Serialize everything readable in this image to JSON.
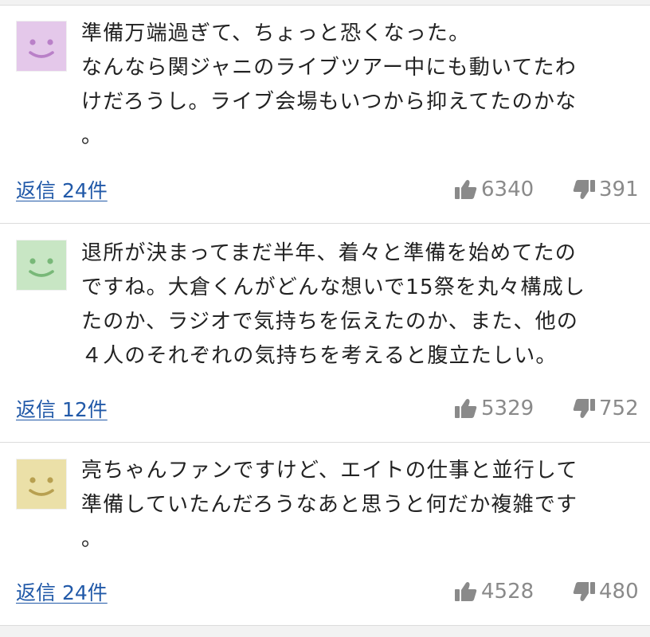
{
  "comments": [
    {
      "avatar": {
        "color": "#e4c8ea",
        "face_color": "#b980c8",
        "icon": "smiley-face-icon"
      },
      "lines": [
        "準備万端過ぎて、ちょっと恐くなった。",
        "なんなら関ジャニのライブツアー中にも動いてたわ",
        "けだろうし。ライブ会場もいつから抑えてたのかな",
        "。"
      ],
      "reply_label": "返信",
      "reply_count": "24件",
      "likes": "6340",
      "dislikes": "391"
    },
    {
      "avatar": {
        "color": "#c8e6c4",
        "face_color": "#78b878",
        "icon": "smiley-face-icon"
      },
      "lines": [
        "退所が決まってまだ半年、着々と準備を始めてたの",
        "ですね。大倉くんがどんな想いで15祭を丸々構成し",
        "たのか、ラジオで気持ちを伝えたのか、また、他の",
        "４人のそれぞれの気持ちを考えると腹立たしい。"
      ],
      "reply_label": "返信",
      "reply_count": "12件",
      "likes": "5329",
      "dislikes": "752"
    },
    {
      "avatar": {
        "color": "#ebe0a8",
        "face_color": "#b8a050",
        "icon": "smiley-face-icon"
      },
      "lines": [
        "亮ちゃんファンですけど、エイトの仕事と並行して",
        "準備していたんだろうなあと思うと何だか複雑です",
        "。"
      ],
      "reply_label": "返信",
      "reply_count": "24件",
      "likes": "4528",
      "dislikes": "480"
    }
  ],
  "colors": {
    "link": "#2159a8",
    "vote_gray": "#8a8a8a",
    "divider": "#dcdcdc",
    "text": "#222222"
  }
}
